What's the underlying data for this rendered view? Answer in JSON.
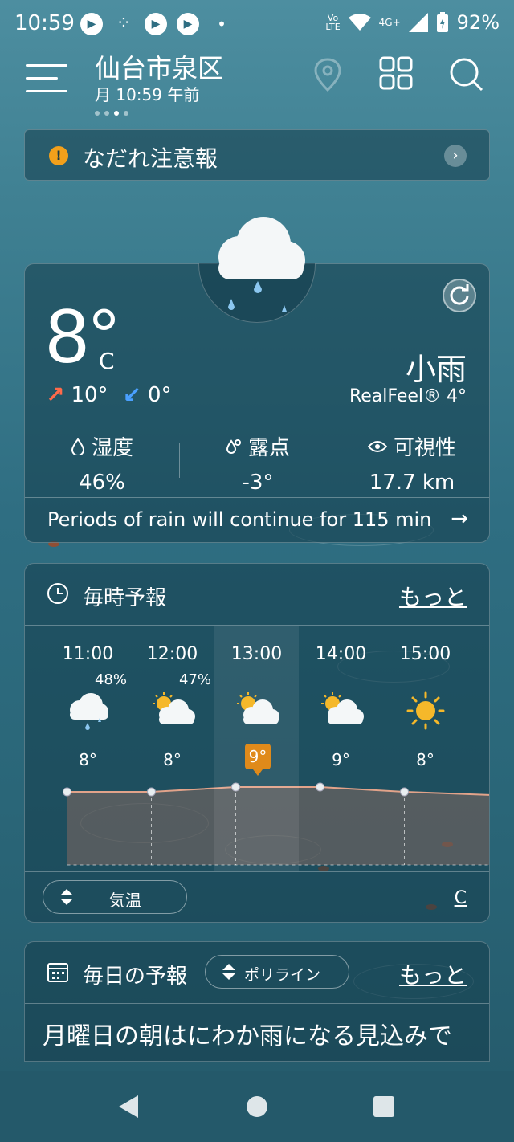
{
  "status_bar": {
    "time": "10:59",
    "network_top": "Vo",
    "network_bottom": "LTE",
    "network_type": "4G+",
    "battery": "92%"
  },
  "header": {
    "location": "仙台市泉区",
    "subtitle": "月 10:59 午前",
    "page_count": 4,
    "active_page": 2
  },
  "alert": {
    "text": "なだれ注意報",
    "icon": "!"
  },
  "current": {
    "temperature": "8°",
    "unit": "C",
    "high": "10°",
    "low": "0°",
    "condition": "小雨",
    "realfeel": "RealFeel® 4°",
    "stats": [
      {
        "label": "湿度",
        "value": "46%",
        "icon": "humidity-icon"
      },
      {
        "label": "露点",
        "value": "-3°",
        "icon": "dew-point-icon"
      },
      {
        "label": "可視性",
        "value": "17.7 km",
        "icon": "visibility-icon"
      }
    ],
    "minutecast": "Periods of rain will continue for 115 min"
  },
  "hourly": {
    "title": "毎時予報",
    "more": "もっと",
    "hours": [
      {
        "time": "11:00",
        "precip": "48%",
        "temp": "8°",
        "icon": "cloud-rain-icon"
      },
      {
        "time": "12:00",
        "precip": "47%",
        "temp": "8°",
        "icon": "partly-sunny-icon"
      },
      {
        "time": "13:00",
        "precip": "",
        "temp": "9°",
        "icon": "partly-sunny-icon"
      },
      {
        "time": "14:00",
        "precip": "",
        "temp": "9°",
        "icon": "partly-sunny-icon"
      },
      {
        "time": "15:00",
        "precip": "",
        "temp": "8°",
        "icon": "sun-icon"
      }
    ],
    "selected_index": 2,
    "metric_label": "気温",
    "unit_label": "C"
  },
  "daily": {
    "title": "毎日の予報",
    "selector": "ポリライン",
    "more": "もっと",
    "headline": "月曜日の朝はにわか雨になる見込みで"
  },
  "chart_data": {
    "type": "area",
    "x": [
      "11:00",
      "12:00",
      "13:00",
      "14:00",
      "15:00"
    ],
    "values": [
      8,
      8,
      9,
      9,
      8
    ],
    "unit": "°C"
  }
}
